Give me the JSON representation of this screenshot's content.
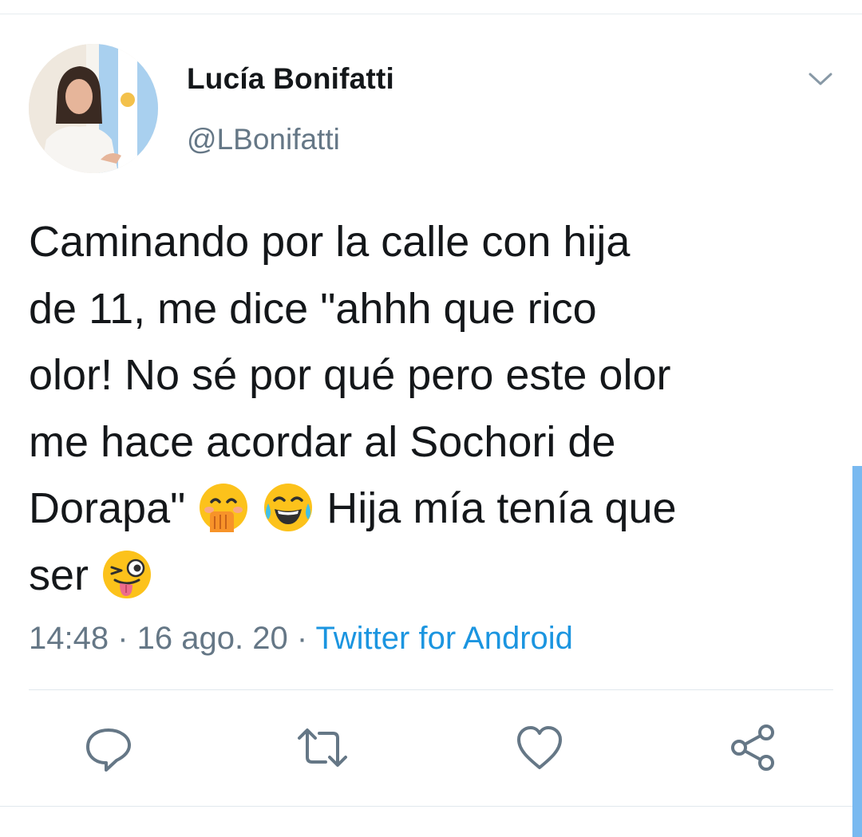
{
  "author": {
    "display_name": "Lucía Bonifatti",
    "handle": "@LBonifatti",
    "avatar_icon": "profile-photo"
  },
  "tweet": {
    "segments": [
      "Caminando por la calle con hija\nde 11, me dice \"ahhh que rico\nolor! No sé por qué pero este olor\nme hace acordar al Sochori de\nDorapa\" ",
      " Hija mía tenía que\nser "
    ],
    "emojis": [
      "face-with-hand-over-mouth",
      "face-with-tears-of-joy",
      "winking-face-with-tongue"
    ]
  },
  "meta": {
    "time": "14:48",
    "separator": " · ",
    "date": "16 ago. 20",
    "source": "Twitter for Android"
  },
  "actions": [
    {
      "name": "reply-icon"
    },
    {
      "name": "retweet-icon"
    },
    {
      "name": "like-icon"
    },
    {
      "name": "share-icon"
    }
  ],
  "colors": {
    "text": "#14171a",
    "secondary": "#657786",
    "link": "#1b95e0",
    "scrollbar": "#79b9f0"
  }
}
